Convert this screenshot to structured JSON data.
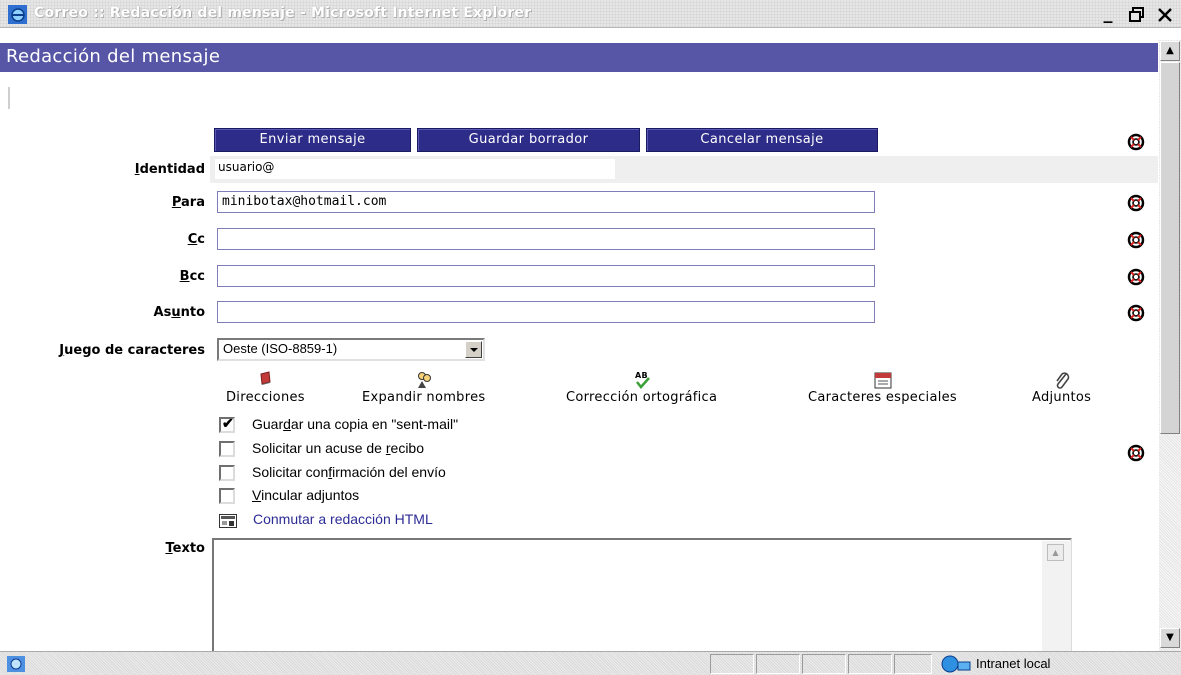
{
  "window": {
    "title": "Correo :: Redacción del mensaje - Microsoft Internet Explorer",
    "controls": {
      "minimize": "_",
      "restore": "🗗",
      "close": "✕"
    }
  },
  "page": {
    "heading": "Redacción del mensaje"
  },
  "actions": {
    "send": "Enviar mensaje",
    "save_draft": "Guardar borrador",
    "cancel": "Cancelar mensaje"
  },
  "form": {
    "identity": {
      "label_pre": "",
      "label_accel": "I",
      "label_post": "dentidad",
      "value": "usuario@"
    },
    "to": {
      "label_pre": "",
      "label_accel": "P",
      "label_post": "ara",
      "value": "minibotax@hotmail.com"
    },
    "cc": {
      "label_pre": "",
      "label_accel": "C",
      "label_post": "c",
      "value": ""
    },
    "bcc": {
      "label_pre": "",
      "label_accel": "B",
      "label_post": "cc",
      "value": ""
    },
    "subject": {
      "label_pre": "As",
      "label_accel": "u",
      "label_post": "nto",
      "value": ""
    },
    "charset": {
      "label_pre": "",
      "label_accel": "J",
      "label_post": "uego de caracteres",
      "selected": "Oeste (ISO-8859-1)"
    },
    "body": {
      "label_pre": "",
      "label_accel": "T",
      "label_post": "exto",
      "value": ""
    }
  },
  "toolbar": {
    "addresses": "Direcciones",
    "expand_names": "Expandir nombres",
    "spellcheck": "Corrección ortográfica",
    "special_chars": "Caracteres especiales",
    "attachments": "Adjuntos"
  },
  "options": [
    {
      "pre": "Guar",
      "accel": "d",
      "post": "ar una copia en \"sent-mail\"",
      "checked": true
    },
    {
      "pre": "Solicitar un acuse de ",
      "accel": "r",
      "post": "ecibo",
      "checked": false
    },
    {
      "pre": "Solicitar con",
      "accel": "f",
      "post": "irmación del envío",
      "checked": false
    },
    {
      "pre": "",
      "accel": "V",
      "post": "incular adjuntos",
      "checked": false
    }
  ],
  "html_switch": "Conmutar a redacción HTML",
  "statusbar": {
    "zone": "Intranet local"
  },
  "colors": {
    "header": "#5755a5",
    "button": "#2d2c89",
    "link": "#2c2c96"
  }
}
